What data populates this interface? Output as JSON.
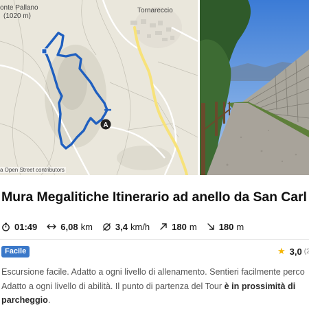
{
  "map": {
    "peak_label": "onte Pallano",
    "peak_elevation": "(1020 m)",
    "town_label": "Tornareccio",
    "attribution": "a Open Street contributors",
    "start_marker": "A",
    "route_color": "#1f5fbf"
  },
  "tour": {
    "title": "Mura Megalitiche Itinerario ad anello da San Carl",
    "stats": {
      "duration": "01:49",
      "distance_value": "6,08",
      "distance_unit": "km",
      "speed_value": "3,4",
      "speed_unit": "km/h",
      "ascent_value": "180",
      "ascent_unit": "m",
      "descent_value": "180",
      "descent_unit": "m"
    },
    "difficulty": "Facile",
    "difficulty_color": "#3a78c9",
    "rating": "3,0",
    "rating_count": "(2",
    "description": {
      "line1": "Escursione facile. Adatto a ogni livello di allenamento. Sentieri facilmente perco",
      "line2_plain": "Adatto a ogni livello di abilità. Il punto di partenza del Tour ",
      "line2_bold": "è in prossimità di",
      "line3_bold": "parcheggio",
      "line3_end": "."
    }
  }
}
